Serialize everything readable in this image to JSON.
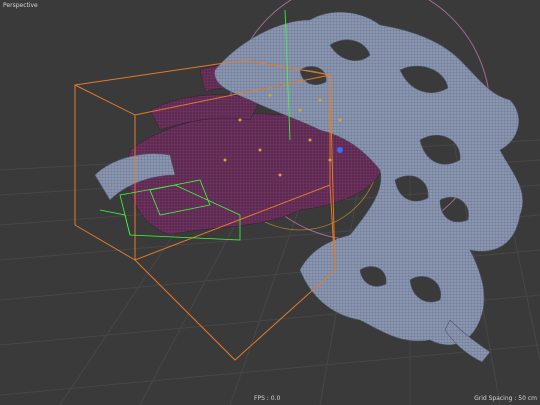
{
  "viewport": {
    "view_name": "Perspective",
    "status": {
      "fps": "FPS : 0.0",
      "grid_spacing": "Grid Spacing : 50 cm"
    }
  },
  "colors": {
    "background": "#3a3a3a",
    "grid_line": "#4a4a4a",
    "mesh_light": "#8e9ab3",
    "mesh_dark": "#6a2a55",
    "bounding_box": "#e07a2a",
    "light_circle": "#b07aa8",
    "selection": "#3aff3a",
    "axis_y": "#3aff3a"
  },
  "icons": [
    "view-axis-icon"
  ]
}
